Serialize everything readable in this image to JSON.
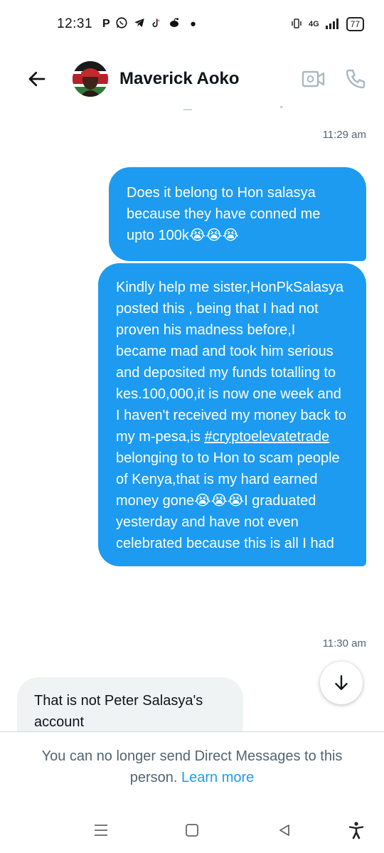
{
  "status_bar": {
    "time": "12:31",
    "app_glyphs": [
      "P",
      "whatsapp-icon",
      "telegram-icon",
      "tiktok-icon",
      "reddit-icon",
      "dot"
    ],
    "network": "4G",
    "battery": "77"
  },
  "header": {
    "contact_name": "Maverick Aoko"
  },
  "messages": [
    {
      "type": "timestamp",
      "text": "11:29 am"
    },
    {
      "type": "sent",
      "text": "Does it belong to Hon salasya because they have conned me upto 100k😭😭😭"
    },
    {
      "type": "sent",
      "text_before_link": "Kindly help me sister,HonPkSalasya posted this , being that I had not proven his madness before,I became mad and took him serious and deposited my funds totalling to kes.100,000,it is now one week and I haven't received my money back to my m-pesa,is ",
      "link": "#cryptoelevatetrade",
      "text_after_link": " belonging to to Hon to scam people of Kenya,that is my hard earned money gone😭😭😭I graduated yesterday and have not even celebrated because this is all I had"
    },
    {
      "type": "timestamp",
      "text": "11:30 am"
    },
    {
      "type": "received",
      "text": "That is not Peter Salasya's account"
    }
  ],
  "footer": {
    "note": "You can no longer send Direct Messages to this person.",
    "learn_more": "Learn more"
  },
  "colors": {
    "accent": "#1d9bf0",
    "received_bubble": "#eff3f4",
    "secondary_text": "#536471"
  }
}
